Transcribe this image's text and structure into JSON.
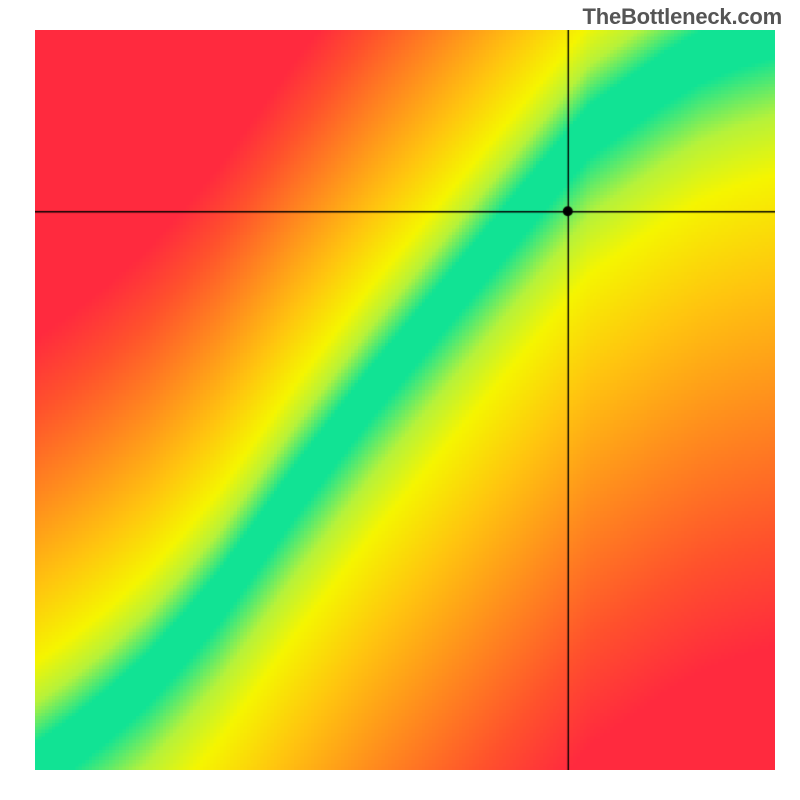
{
  "watermark": "TheBottleneck.com",
  "chart_data": {
    "type": "heatmap",
    "title": "",
    "xlabel": "",
    "ylabel": "",
    "xlim": [
      0,
      1
    ],
    "ylim": [
      0,
      1
    ],
    "crosshair": {
      "x": 0.72,
      "y": 0.755
    },
    "marker": {
      "x": 0.72,
      "y": 0.755,
      "radius_px": 5
    },
    "optimal_curve": {
      "comment": "approximate centreline of the green band (fraction coords, 0..1, y from bottom)",
      "x": [
        0.0,
        0.05,
        0.1,
        0.15,
        0.2,
        0.25,
        0.3,
        0.35,
        0.4,
        0.45,
        0.5,
        0.55,
        0.6,
        0.65,
        0.7,
        0.75,
        0.8,
        0.85,
        0.9,
        0.95,
        1.0
      ],
      "y": [
        0.0,
        0.035,
        0.075,
        0.12,
        0.175,
        0.235,
        0.305,
        0.375,
        0.44,
        0.505,
        0.565,
        0.625,
        0.685,
        0.745,
        0.805,
        0.865,
        0.9,
        0.935,
        0.965,
        0.985,
        1.0
      ]
    },
    "band_halfwidth_frac": 0.035,
    "gradient_stops": [
      {
        "t": 0.0,
        "color": "#ff2a3e"
      },
      {
        "t": 0.18,
        "color": "#ff512c"
      },
      {
        "t": 0.4,
        "color": "#ff8a1e"
      },
      {
        "t": 0.62,
        "color": "#ffc40f"
      },
      {
        "t": 0.8,
        "color": "#f5f500"
      },
      {
        "t": 0.9,
        "color": "#b6f23a"
      },
      {
        "t": 1.0,
        "color": "#11e394"
      }
    ]
  }
}
